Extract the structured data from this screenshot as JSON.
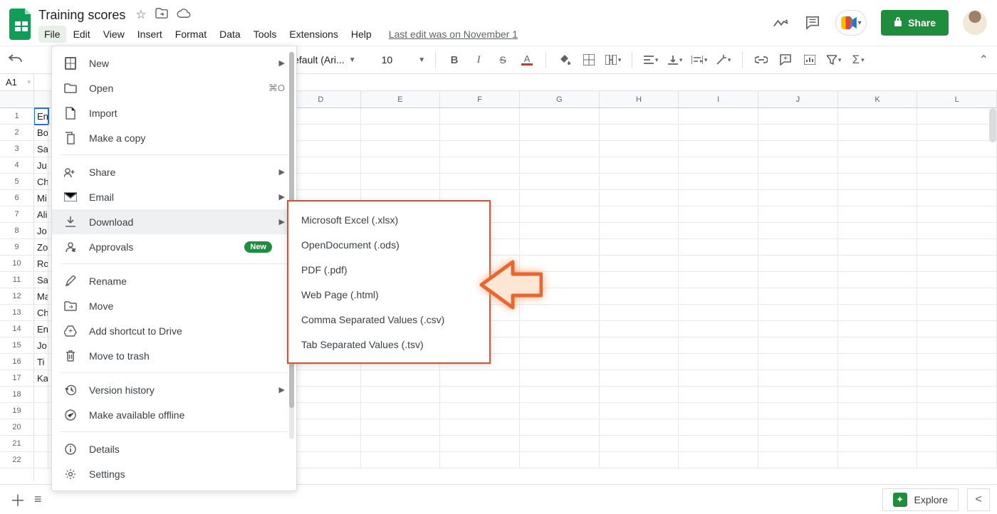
{
  "doc_title": "Training scores",
  "last_edit": "Last edit was on November 1",
  "menu_bar": [
    "File",
    "Edit",
    "View",
    "Insert",
    "Format",
    "Data",
    "Tools",
    "Extensions",
    "Help"
  ],
  "share_label": "Share",
  "toolbar": {
    "font": "Default (Ari...",
    "size": "10"
  },
  "namebox": "A1",
  "columns": [
    "D",
    "E",
    "F",
    "G",
    "H",
    "I",
    "J",
    "K",
    "L"
  ],
  "rows_visible": 22,
  "colA_data": [
    "En",
    "Bo",
    "Sa",
    "Ju",
    "Ch",
    "Mi",
    "Ali",
    "Jo",
    "Zo",
    "Ro",
    "Sa",
    "Ma",
    "Ch",
    "En",
    "Jo",
    "Ti",
    "Ka"
  ],
  "file_menu": {
    "new": "New",
    "open": "Open",
    "open_shortcut": "⌘O",
    "import": "Import",
    "make_copy": "Make a copy",
    "share": "Share",
    "email": "Email",
    "download": "Download",
    "approvals": "Approvals",
    "approvals_badge": "New",
    "rename": "Rename",
    "move": "Move",
    "add_shortcut": "Add shortcut to Drive",
    "trash": "Move to trash",
    "version_history": "Version history",
    "offline": "Make available offline",
    "details": "Details",
    "settings": "Settings"
  },
  "download_menu": [
    "Microsoft Excel (.xlsx)",
    "OpenDocument (.ods)",
    "PDF (.pdf)",
    "Web Page (.html)",
    "Comma Separated Values (.csv)",
    "Tab Separated Values (.tsv)"
  ],
  "explore_label": "Explore"
}
